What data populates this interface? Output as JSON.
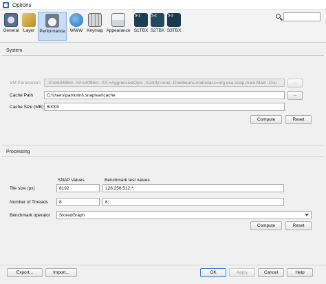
{
  "window": {
    "title": "Options"
  },
  "toolbar": {
    "items": [
      {
        "label": "General",
        "icon": "general-icon"
      },
      {
        "label": "Layer",
        "icon": "layer-icon"
      },
      {
        "label": "Performance",
        "icon": "performance-icon",
        "active": true
      },
      {
        "label": "WWW",
        "icon": "globe-icon"
      },
      {
        "label": "Keymap",
        "icon": "keyboard-icon"
      },
      {
        "label": "Appearance",
        "icon": "appearance-icon"
      },
      {
        "label": "S1TBX",
        "icon": "s1-satellite-icon",
        "badge": "S-1"
      },
      {
        "label": "S2TBX",
        "icon": "s2-satellite-icon",
        "badge": "S-2"
      },
      {
        "label": "S3TBX",
        "icon": "s3-satellite-icon",
        "badge": "S-3"
      }
    ],
    "search": {
      "icon": "search-icon",
      "value": ""
    }
  },
  "system": {
    "title": "System",
    "vm_parameters": {
      "label": "VM Parameters",
      "value": "-Xmx63488m -Xms4096m -XX:+AggressiveOpts -Xverify:none -Dnetbeans.mainclass=org.esa.snap.main.Main -Dsu",
      "button": "..."
    },
    "cache_path": {
      "label": "Cache Path",
      "value": "C:\\Users\\pamorini\\.snap\\var\\cache",
      "button": "..."
    },
    "cache_size": {
      "label": "Cache Size (MB)",
      "value": "60000"
    },
    "compute_label": "Compute",
    "reset_label": "Reset"
  },
  "processing": {
    "title": "Processing",
    "columns": {
      "snap": "SNAP Values",
      "benchmark": "Benchmark test values"
    },
    "tile_size": {
      "label": "Tile size (px)",
      "snap": "8192",
      "benchmark": "128;256;512;*;"
    },
    "threads": {
      "label": "Number of Threads",
      "snap": "8",
      "benchmark": "8;"
    },
    "benchmark_operator": {
      "label": "Benchmark operator",
      "value": "StoredGraph"
    },
    "compute_label": "Compute",
    "reset_label": "Reset"
  },
  "footer": {
    "export_label": "Export...",
    "import_label": "Import...",
    "ok_label": "OK",
    "apply_label": "Apply",
    "cancel_label": "Cancel",
    "help_label": "Help"
  },
  "colors": {
    "accent": "#3f7fd1",
    "active_tab": "#c9dcf5"
  }
}
